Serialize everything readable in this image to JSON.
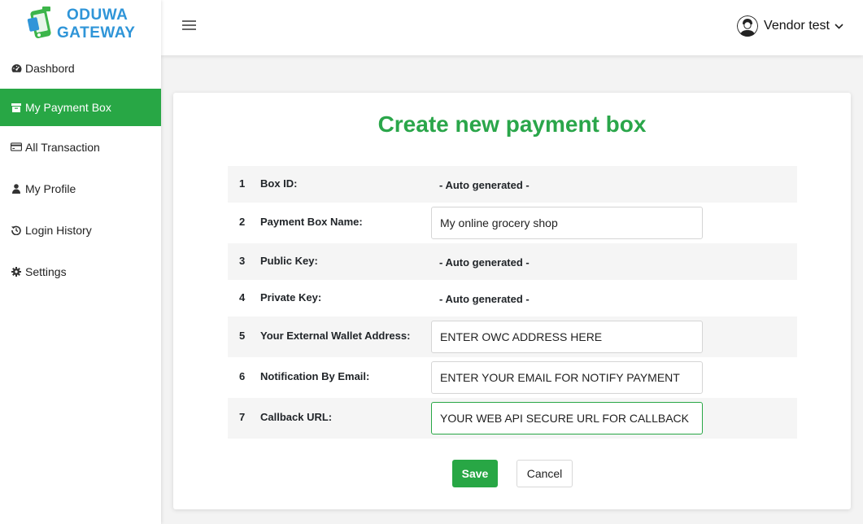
{
  "brand": {
    "line1": "ODUWA",
    "line2": "GATEWAY",
    "color": "#2f95d8",
    "accent": "#28a745"
  },
  "sidebar": {
    "items": [
      {
        "label": "Dashbord",
        "icon": "tachometer-icon",
        "active": false
      },
      {
        "label": "My Payment Box",
        "icon": "archive-icon",
        "active": true
      },
      {
        "label": "All Transaction",
        "icon": "credit-card-icon",
        "active": false
      },
      {
        "label": "My Profile",
        "icon": "user-icon",
        "active": false
      },
      {
        "label": "Login History",
        "icon": "history-icon",
        "active": false
      },
      {
        "label": "Settings",
        "icon": "gear-icon",
        "active": false
      }
    ]
  },
  "topbar": {
    "user_name": "Vendor test",
    "menu_icon": "hamburger-icon",
    "dropdown_icon": "chevron-down-icon"
  },
  "form": {
    "title": "Create new payment box",
    "rows": [
      {
        "num": "1",
        "label": "Box ID:",
        "value": "- Auto generated -"
      },
      {
        "num": "2",
        "label": "Payment Box Name:",
        "value": "My online grocery shop"
      },
      {
        "num": "3",
        "label": "Public Key:",
        "value": "- Auto generated -"
      },
      {
        "num": "4",
        "label": "Private Key:",
        "value": "- Auto generated -"
      },
      {
        "num": "5",
        "label": "Your External Wallet Address:",
        "value": "ENTER OWC ADDRESS HERE"
      },
      {
        "num": "6",
        "label": "Notification By Email:",
        "value": "ENTER YOUR EMAIL FOR NOTIFY PAYMENT"
      },
      {
        "num": "7",
        "label": "Callback URL:",
        "value": "YOUR WEB API SECURE URL FOR CALLBACK"
      }
    ],
    "save_label": "Save",
    "cancel_label": "Cancel"
  }
}
